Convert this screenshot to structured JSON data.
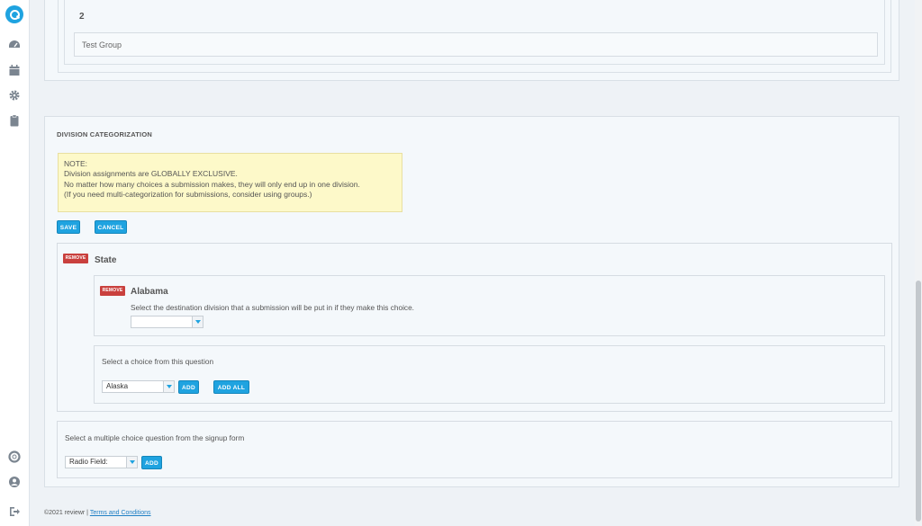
{
  "top_group": {
    "number": "2",
    "group_name": "Test Group"
  },
  "division": {
    "title": "DIVISION CATEGORIZATION",
    "note_lines": [
      "NOTE:",
      "Division assignments are GLOBALLY EXCLUSIVE.",
      "No matter how many choices a submission makes, they will only end up in one division.",
      "(If you need multi-categorization for submissions, consider using groups.)"
    ],
    "save_label": "SAVE",
    "cancel_label": "CANCEL",
    "question": {
      "remove_label": "REMOVE",
      "title": "State",
      "choice": {
        "remove_label": "REMOVE",
        "title": "Alabama",
        "instruction": "Select the destination division that a submission will be put in if they make this choice.",
        "division_select_value": ""
      },
      "add_choice": {
        "prompt": "Select a choice from this question",
        "select_value": "Alaska",
        "add_label": "ADD",
        "add_all_label": "ADD ALL"
      }
    },
    "add_question": {
      "prompt": "Select a multiple choice question from the signup form",
      "select_value": "Radio Field:",
      "add_label": "ADD"
    }
  },
  "footer": {
    "copyright": "©2021 reviewr |",
    "terms_link": "Terms and Conditions"
  },
  "sidebar": {
    "icons": [
      "reviewr-logo-icon",
      "dashboard-gauge-icon",
      "calendar-icon",
      "gear-icon",
      "clipboard-icon",
      "help-lifebuoy-icon",
      "user-profile-icon",
      "logout-icon"
    ]
  },
  "colors": {
    "accent": "#1fa3e0",
    "danger": "#c9403d",
    "note_bg": "#fdf9c9"
  }
}
